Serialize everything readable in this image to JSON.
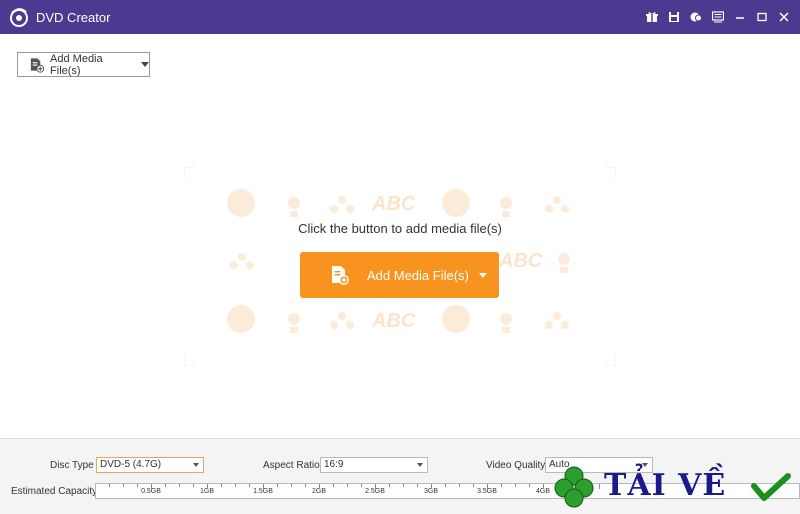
{
  "window": {
    "title": "DVD Creator"
  },
  "toolbar": {
    "add_media_label": "Add Media File(s)"
  },
  "main": {
    "prompt": "Click the button to add media file(s)",
    "add_media_label": "Add Media File(s)",
    "placeholder_text": "ABC"
  },
  "settings": {
    "disc_type_label": "Disc Type",
    "disc_type_value": "DVD-5 (4.7G)",
    "aspect_ratio_label": "Aspect Ratio:",
    "aspect_ratio_value": "16:9",
    "video_quality_label": "Video Quality:",
    "video_quality_value": "Auto",
    "capacity_label": "Estimated Capacity:",
    "capacity_ticks": [
      "0.5GB",
      "1GB",
      "1.5GB",
      "2GB",
      "2.5GB",
      "3GB",
      "3.5GB",
      "4GB"
    ]
  },
  "watermark": {
    "text": "TẢI VỀ"
  },
  "colors": {
    "titlebar": "#4b3a8f",
    "accent": "#f7931e"
  },
  "icons": [
    "logo-icon",
    "gift-icon",
    "save-icon",
    "chat-icon",
    "feedback-icon",
    "minimize-icon",
    "maximize-icon",
    "close-icon",
    "add-file-icon",
    "clover-icon",
    "checkmark-icon"
  ]
}
